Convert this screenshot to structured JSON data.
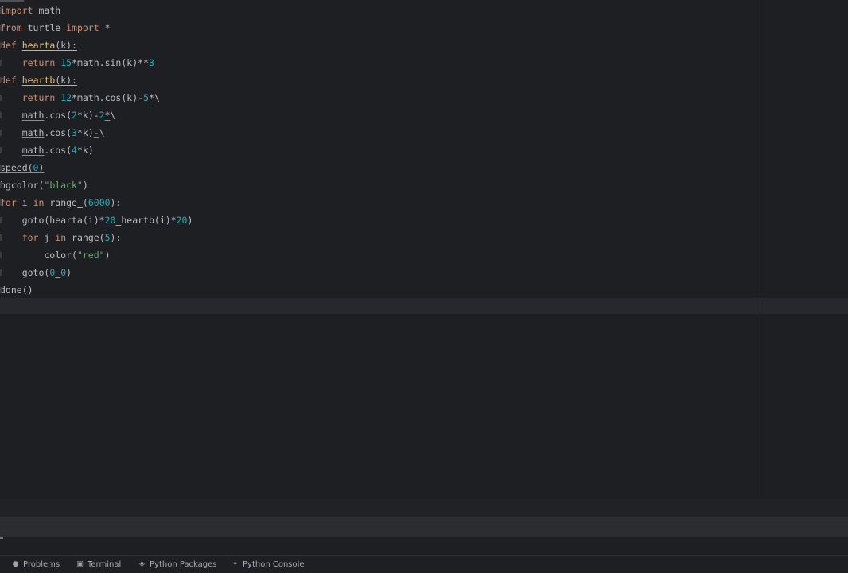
{
  "editor": {
    "lines": [
      [
        {
          "t": "import",
          "c": "kw"
        },
        {
          "t": " math",
          "c": "plain"
        }
      ],
      [
        {
          "t": "from",
          "c": "kw"
        },
        {
          "t": " turtle ",
          "c": "plain"
        },
        {
          "t": "import",
          "c": "kw"
        },
        {
          "t": " *",
          "c": "plain"
        }
      ],
      [
        {
          "t": "def",
          "c": "kw"
        },
        {
          "t": " ",
          "c": "plain"
        },
        {
          "t": "hearta",
          "c": "fn hdr-ul"
        },
        {
          "t": "(k):",
          "c": "plain hdr-ul"
        }
      ],
      [
        {
          "t": "    ",
          "c": "plain"
        },
        {
          "t": "return",
          "c": "kw"
        },
        {
          "t": " ",
          "c": "plain"
        },
        {
          "t": "15",
          "c": "num"
        },
        {
          "t": "*math.sin(k)**",
          "c": "plain"
        },
        {
          "t": "3",
          "c": "num"
        }
      ],
      [
        {
          "t": "def",
          "c": "kw"
        },
        {
          "t": " ",
          "c": "plain"
        },
        {
          "t": "heartb",
          "c": "fn hdr-ul"
        },
        {
          "t": "(k):",
          "c": "plain hdr-ul"
        }
      ],
      [
        {
          "t": "    ",
          "c": "plain"
        },
        {
          "t": "return",
          "c": "kw"
        },
        {
          "t": " ",
          "c": "plain"
        },
        {
          "t": "12",
          "c": "num"
        },
        {
          "t": "*math.cos(k)-",
          "c": "plain"
        },
        {
          "t": "5",
          "c": "num"
        },
        {
          "t": "*",
          "c": "plain ul"
        },
        {
          "t": "\\",
          "c": "plain"
        }
      ],
      [
        {
          "t": "    ",
          "c": "plain"
        },
        {
          "t": "math",
          "c": "plain ul"
        },
        {
          "t": ".cos(",
          "c": "plain"
        },
        {
          "t": "2",
          "c": "num"
        },
        {
          "t": "*k)-",
          "c": "plain"
        },
        {
          "t": "2",
          "c": "num"
        },
        {
          "t": "*",
          "c": "plain ul"
        },
        {
          "t": "\\",
          "c": "plain"
        }
      ],
      [
        {
          "t": "    ",
          "c": "plain"
        },
        {
          "t": "math",
          "c": "plain ul"
        },
        {
          "t": ".cos(",
          "c": "plain"
        },
        {
          "t": "3",
          "c": "num"
        },
        {
          "t": "*k)",
          "c": "plain"
        },
        {
          "t": "-",
          "c": "plain ul"
        },
        {
          "t": "\\",
          "c": "plain"
        }
      ],
      [
        {
          "t": "    ",
          "c": "plain"
        },
        {
          "t": "math",
          "c": "plain ul"
        },
        {
          "t": ".cos(",
          "c": "plain"
        },
        {
          "t": "4",
          "c": "num"
        },
        {
          "t": "*k)",
          "c": "plain"
        }
      ],
      [
        {
          "t": "speed(",
          "c": "plain ul"
        },
        {
          "t": "0",
          "c": "num ul"
        },
        {
          "t": ")",
          "c": "plain ul"
        }
      ],
      [
        {
          "t": "bgcolor(",
          "c": "plain"
        },
        {
          "t": "\"black\"",
          "c": "str"
        },
        {
          "t": ")",
          "c": "plain"
        }
      ],
      [
        {
          "t": "for",
          "c": "kw"
        },
        {
          "t": " i ",
          "c": "plain"
        },
        {
          "t": "in",
          "c": "kw"
        },
        {
          "t": " range",
          "c": "plain"
        },
        {
          "t": "_",
          "c": "plain ul"
        },
        {
          "t": "(",
          "c": "plain"
        },
        {
          "t": "6000",
          "c": "num"
        },
        {
          "t": "):",
          "c": "plain"
        }
      ],
      [
        {
          "t": "    goto(hearta(i)*",
          "c": "plain"
        },
        {
          "t": "20",
          "c": "num"
        },
        {
          "t": "_",
          "c": "plain ul"
        },
        {
          "t": "heartb(i)*",
          "c": "plain"
        },
        {
          "t": "20",
          "c": "num"
        },
        {
          "t": ")",
          "c": "plain"
        }
      ],
      [
        {
          "t": "    ",
          "c": "plain"
        },
        {
          "t": "for",
          "c": "kw"
        },
        {
          "t": " j ",
          "c": "plain"
        },
        {
          "t": "in",
          "c": "kw"
        },
        {
          "t": " range(",
          "c": "plain"
        },
        {
          "t": "5",
          "c": "num"
        },
        {
          "t": "):",
          "c": "plain"
        }
      ],
      [
        {
          "t": "        color(",
          "c": "plain"
        },
        {
          "t": "\"red\"",
          "c": "str"
        },
        {
          "t": ")",
          "c": "plain"
        }
      ],
      [
        {
          "t": "    goto(",
          "c": "plain"
        },
        {
          "t": "0",
          "c": "num"
        },
        {
          "t": "_",
          "c": "plain ul"
        },
        {
          "t": "0",
          "c": "num"
        },
        {
          "t": ")",
          "c": "plain"
        }
      ],
      [
        {
          "t": "done()",
          "c": "plain"
        }
      ]
    ]
  },
  "toolbar": {
    "tabs": [
      {
        "label": "Problems",
        "icon": "problems-icon",
        "glyph": "●"
      },
      {
        "label": "Terminal",
        "icon": "terminal-icon",
        "glyph": "▣"
      },
      {
        "label": "Python Packages",
        "icon": "packages-icon",
        "glyph": "◈"
      },
      {
        "label": "Python Console",
        "icon": "console-icon",
        "glyph": "✦"
      }
    ]
  },
  "colors": {
    "background": "#1e1f22",
    "keyword": "#cf8e6d",
    "function": "#e8c46a",
    "string": "#6aab73",
    "number": "#2aacb8",
    "text": "#bcbec4"
  }
}
